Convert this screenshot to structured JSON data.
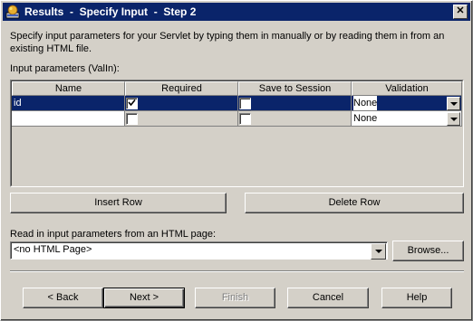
{
  "window": {
    "title": "Results  -  Specify Input  -  Step 2",
    "close_glyph": "✕"
  },
  "description": "Specify input parameters for your Servlet by typing them in manually or by reading them in from an existing HTML file.",
  "params_label": "Input parameters (ValIn):",
  "table": {
    "columns": [
      "Name",
      "Required",
      "Save to Session",
      "Validation"
    ],
    "rows": [
      {
        "name": "id",
        "required": true,
        "save_to_session": false,
        "validation": "None",
        "selected": true
      },
      {
        "name": "",
        "required": false,
        "save_to_session": false,
        "validation": "None",
        "selected": false
      }
    ]
  },
  "buttons": {
    "insert_row": "Insert Row",
    "delete_row": "Delete Row",
    "browse": "Browse...",
    "back": "< Back",
    "next": "Next >",
    "finish": "Finish",
    "cancel": "Cancel",
    "help": "Help"
  },
  "html_page": {
    "label": "Read in input parameters from an HTML page:",
    "selected": "<no HTML Page>"
  },
  "icons": {
    "app": "results-wizard-icon",
    "close": "close-icon",
    "dropdown": "chevron-down-icon",
    "check": "checkmark-icon"
  },
  "colors": {
    "titlebar": "#0a246a",
    "selection": "#0a246a",
    "face": "#d4d0c8"
  }
}
